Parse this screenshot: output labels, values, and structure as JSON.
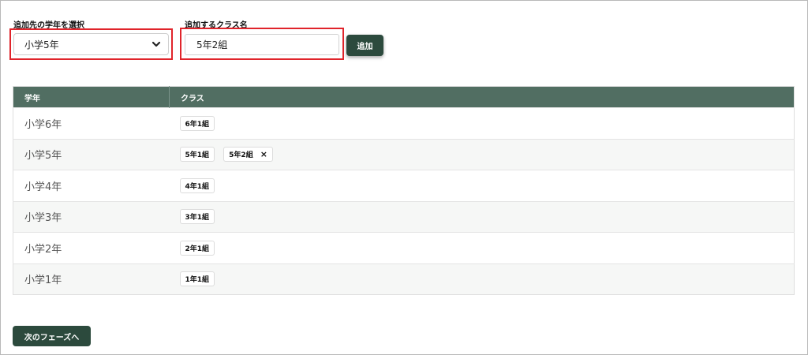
{
  "form": {
    "grade_label": "追加先の学年を選択",
    "grade_selected": "小学5年",
    "class_label": "追加するクラス名",
    "class_value": "5年2組",
    "add_label": "追加"
  },
  "table": {
    "headers": [
      "学年",
      "クラス"
    ],
    "rows": [
      {
        "grade": "小学6年",
        "classes": [
          "6年1組"
        ]
      },
      {
        "grade": "小学5年",
        "classes": [
          "5年1組",
          "5年2組"
        ]
      },
      {
        "grade": "小学4年",
        "classes": [
          "4年1組"
        ]
      },
      {
        "grade": "小学3年",
        "classes": [
          "3年1組"
        ]
      },
      {
        "grade": "小学2年",
        "classes": [
          "2年1組"
        ]
      },
      {
        "grade": "小学1年",
        "classes": [
          "1年1組"
        ]
      }
    ],
    "remove_icon": "×"
  },
  "footer": {
    "next_label": "次のフェーズへ"
  },
  "colors": {
    "accent": "#2c4a3d",
    "header": "#516e62",
    "highlight": "#e0242b"
  }
}
